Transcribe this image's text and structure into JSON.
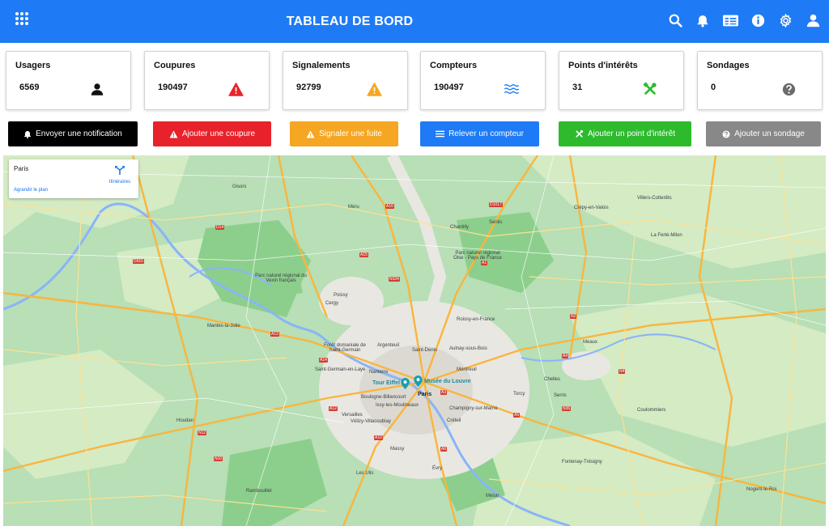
{
  "header": {
    "title": "TABLEAU DE BORD",
    "bg_color": "#1e7bf5",
    "icons": [
      "apps-grid-icon",
      "search-icon",
      "bell-icon",
      "card-icon",
      "info-icon",
      "gear-icon",
      "user-icon"
    ]
  },
  "stats": [
    {
      "label": "Usagers",
      "value": "6569",
      "icon": "user-icon",
      "color": "#111111"
    },
    {
      "label": "Coupures",
      "value": "190497",
      "icon": "warning-icon",
      "color": "#e8222b"
    },
    {
      "label": "Signalements",
      "value": "92799",
      "icon": "warning-icon",
      "color": "#f5a623"
    },
    {
      "label": "Compteurs",
      "value": "190497",
      "icon": "water-icon",
      "color": "#1e7bf5"
    },
    {
      "label": "Points d'intérêts",
      "value": "31",
      "icon": "tools-icon",
      "color": "#2dbb2d"
    },
    {
      "label": "Sondages",
      "value": "0",
      "icon": "question-icon",
      "color": "#6b6b6b"
    }
  ],
  "actions": [
    {
      "label": "Envoyer une notification",
      "icon": "bell-icon",
      "color": "#000000"
    },
    {
      "label": "Ajouter une coupure",
      "icon": "warning-icon",
      "color": "#e8222b"
    },
    {
      "label": "Signaler une fuite",
      "icon": "warning-icon",
      "color": "#f5a623"
    },
    {
      "label": "Relever un compteur",
      "icon": "bars-icon",
      "color": "#1e7bf5"
    },
    {
      "label": "Ajouter un point d'intérêt",
      "icon": "tools-icon",
      "color": "#2dbb2d"
    },
    {
      "label": "Ajouter un sondage",
      "icon": "question-icon",
      "color": "#888888"
    }
  ],
  "map": {
    "infobox": {
      "place": "Paris",
      "route_label": "Itinéraires",
      "enlarge": "Agrandir le plan"
    },
    "pins": [
      {
        "label": "Tour Eiffel"
      },
      {
        "label": "Musée du Louvre"
      }
    ],
    "labels": [
      {
        "text": "Paris",
        "big": true
      },
      {
        "text": "Argenteuil",
        "big": false
      },
      {
        "text": "Saint-Denis",
        "big": false
      },
      {
        "text": "Nanterre",
        "big": false
      },
      {
        "text": "Boulogne-Billancourt",
        "big": false
      },
      {
        "text": "Versailles",
        "big": false
      },
      {
        "text": "Créteil",
        "big": false
      },
      {
        "text": "Cergy",
        "big": false
      },
      {
        "text": "Poissy",
        "big": false
      },
      {
        "text": "Montreuil",
        "big": false
      },
      {
        "text": "Massy",
        "big": false
      },
      {
        "text": "Meaux",
        "big": false
      },
      {
        "text": "Senlis",
        "big": false
      },
      {
        "text": "Chantilly",
        "big": false
      },
      {
        "text": "Rambouillet",
        "big": false
      },
      {
        "text": "Mantes-la-Jolie",
        "big": false
      },
      {
        "text": "Roissy-en-France",
        "big": false
      },
      {
        "text": "Torcy",
        "big": false
      },
      {
        "text": "Évry",
        "big": false
      },
      {
        "text": "Les Ulis",
        "big": false
      },
      {
        "text": "Coulommiers",
        "big": false
      },
      {
        "text": "Gisors",
        "big": false
      },
      {
        "text": "Chelles",
        "big": false
      },
      {
        "text": "Saint-Germain-en-Laye",
        "big": false
      },
      {
        "text": "Aulnay-sous-Bois",
        "big": false
      },
      {
        "text": "Issy-les-Moulineaux",
        "big": false
      },
      {
        "text": "Vélizy-Villacoublay",
        "big": false
      },
      {
        "text": "Parc naturel régional du Vexin français",
        "big": false
      },
      {
        "text": "Parc naturel régional Oise - Pays de France",
        "big": false
      },
      {
        "text": "Forêt domaniale de Saint-Germain",
        "big": false
      },
      {
        "text": "Champigny-sur-Marne",
        "big": false
      },
      {
        "text": "Serris",
        "big": false
      },
      {
        "text": "Melun",
        "big": false
      },
      {
        "text": "Fontenay-Trésigny",
        "big": false
      },
      {
        "text": "Villers-Cotterêts",
        "big": false
      },
      {
        "text": "La Ferté-Milon",
        "big": false
      },
      {
        "text": "Nogent-le-Roi",
        "big": false
      },
      {
        "text": "Houdan",
        "big": false
      },
      {
        "text": "Méru",
        "big": false
      },
      {
        "text": "Crépy-en-Valois",
        "big": false
      }
    ],
    "roads": [
      "A16",
      "A15",
      "A14",
      "A13",
      "A12",
      "A10",
      "A6",
      "A5",
      "A4",
      "A3",
      "A1",
      "N104",
      "D14",
      "N12",
      "N10",
      "N2",
      "N4",
      "N36",
      "D915",
      "D1017"
    ]
  }
}
